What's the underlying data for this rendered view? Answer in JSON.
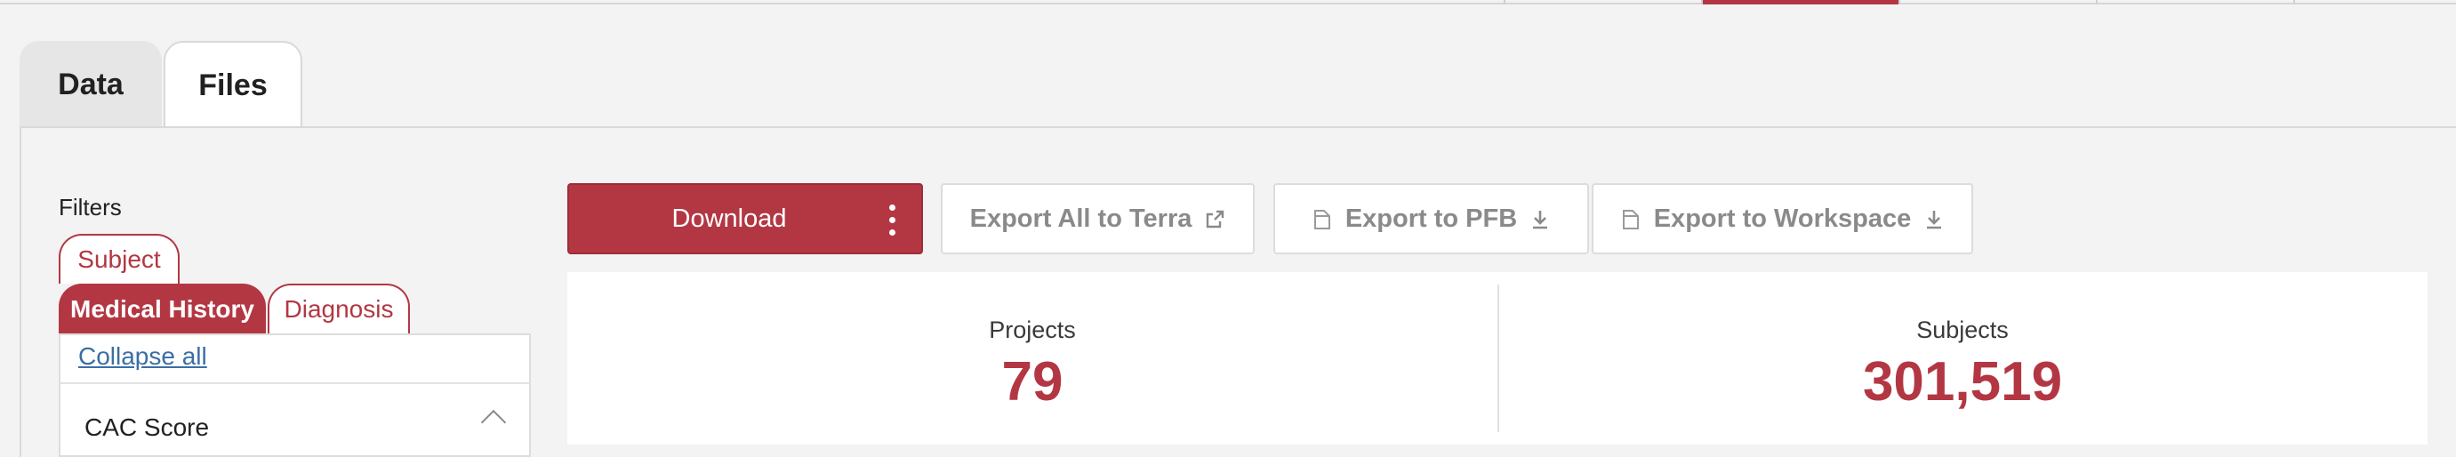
{
  "tabs": [
    {
      "label": "Data"
    },
    {
      "label": "Files"
    }
  ],
  "filters": {
    "title": "Filters",
    "tabs": [
      "Subject",
      "Medical History",
      "Diagnosis"
    ],
    "collapse_all": "Collapse all",
    "sections": [
      {
        "label": "CAC Score"
      }
    ]
  },
  "toolbar": {
    "download": "Download",
    "export_terra": "Export All to Terra",
    "export_pfb": "Export to PFB",
    "export_workspace": "Export to Workspace"
  },
  "stats": [
    {
      "label": "Projects",
      "value": "79"
    },
    {
      "label": "Subjects",
      "value": "301,519"
    }
  ],
  "colors": {
    "accent": "#b33743",
    "link": "#3a6ea5"
  },
  "icons": {
    "terra": "external-link-icon",
    "pfb": "file-icon",
    "download": "download-icon"
  }
}
